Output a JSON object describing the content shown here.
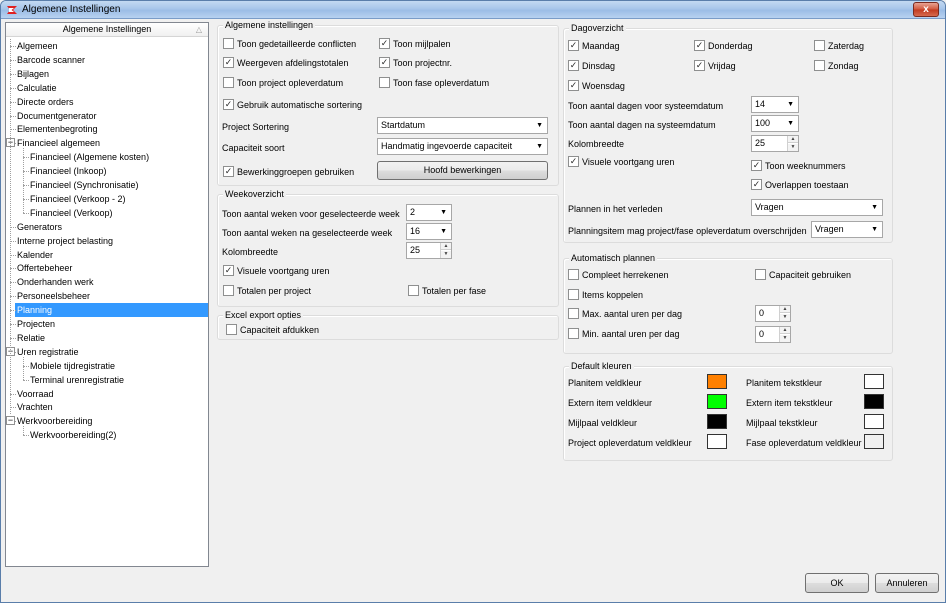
{
  "window": {
    "title": "Algemene Instellingen",
    "close_label": "x"
  },
  "tree": {
    "header": "Algemene Instellingen",
    "items": [
      {
        "label": "Algemeen",
        "level": 0
      },
      {
        "label": "Barcode scanner",
        "level": 0
      },
      {
        "label": "Bijlagen",
        "level": 0
      },
      {
        "label": "Calculatie",
        "level": 0
      },
      {
        "label": "Directe orders",
        "level": 0
      },
      {
        "label": "Documentgenerator",
        "level": 0
      },
      {
        "label": "Elementenbegroting",
        "level": 0
      },
      {
        "label": "Financieel algemeen",
        "level": 0,
        "expander": "-"
      },
      {
        "label": "Financieel (Algemene kosten)",
        "level": 1
      },
      {
        "label": "Financieel (Inkoop)",
        "level": 1
      },
      {
        "label": "Financieel (Synchronisatie)",
        "level": 1
      },
      {
        "label": "Financieel (Verkoop - 2)",
        "level": 1
      },
      {
        "label": "Financieel (Verkoop)",
        "level": 1
      },
      {
        "label": "Generators",
        "level": 0
      },
      {
        "label": "Interne project belasting",
        "level": 0
      },
      {
        "label": "Kalender",
        "level": 0
      },
      {
        "label": "Offertebeheer",
        "level": 0
      },
      {
        "label": "Onderhanden werk",
        "level": 0
      },
      {
        "label": "Personeelsbeheer",
        "level": 0
      },
      {
        "label": "Planning",
        "level": 0,
        "selected": true
      },
      {
        "label": "Projecten",
        "level": 0
      },
      {
        "label": "Relatie",
        "level": 0
      },
      {
        "label": "Uren registratie",
        "level": 0,
        "expander": "-"
      },
      {
        "label": "Mobiele tijdregistratie",
        "level": 1
      },
      {
        "label": "Terminal urenregistratie",
        "level": 1
      },
      {
        "label": "Voorraad",
        "level": 0
      },
      {
        "label": "Vrachten",
        "level": 0
      },
      {
        "label": "Werkvoorbereiding",
        "level": 0,
        "expander": "-"
      },
      {
        "label": "Werkvoorbereiding(2)",
        "level": 1
      }
    ]
  },
  "algemene": {
    "title": "Algemene instellingen",
    "cb_conflicten": "Toon gedetailleerde conflicten",
    "cb_mijlpalen": "Toon mijlpalen",
    "cb_afdelingstotalen": "Weergeven afdelingstotalen",
    "cb_projectnr": "Toon projectnr.",
    "cb_project_opleverdatum": "Toon project opleverdatum",
    "cb_fase_opleverdatum": "Toon fase opleverdatum",
    "cb_sortering": "Gebruik automatische sortering",
    "project_sortering_label": "Project Sortering",
    "project_sortering_value": "Startdatum",
    "capaciteit_soort_label": "Capaciteit soort",
    "capaciteit_soort_value": "Handmatig ingevoerde capaciteit",
    "cb_bewerkingsgroepen": "Bewerkinggroepen gebruiken",
    "hoofd_button": "Hoofd bewerkingen"
  },
  "week": {
    "title": "Weekoverzicht",
    "voor_label": "Toon aantal weken voor geselecteerde week",
    "voor_value": "2",
    "na_label": "Toon aantal weken na geselecteerde week",
    "na_value": "16",
    "kolom_label": "Kolombreedte",
    "kolom_value": "25",
    "cb_voortgang": "Visuele voortgang uren",
    "cb_totalen_project": "Totalen per project",
    "cb_totalen_fase": "Totalen per fase"
  },
  "excel": {
    "title": "Excel export opties",
    "cb_capaciteit": "Capaciteit afdukken"
  },
  "dag": {
    "title": "Dagoverzicht",
    "maandag": "Maandag",
    "donderdag": "Donderdag",
    "zaterdag": "Zaterdag",
    "dinsdag": "Dinsdag",
    "vrijdag": "Vrijdag",
    "zondag": "Zondag",
    "woensdag": "Woensdag",
    "voor_label": "Toon aantal dagen voor systeemdatum",
    "voor_value": "14",
    "na_label": "Toon aantal dagen na systeemdatum",
    "na_value": "100",
    "kolom_label": "Kolombreedte",
    "kolom_value": "25",
    "cb_voortgang": "Visuele voortgang uren",
    "cb_weeknummers": "Toon weeknummers",
    "cb_overlappen": "Overlappen toestaan",
    "verleden_label": "Plannen in het verleden",
    "verleden_value": "Vragen",
    "overschrijden_label": "Planningsitem mag project/fase opleverdatum overschrijden",
    "overschrijden_value": "Vragen"
  },
  "auto": {
    "title": "Automatisch plannen",
    "cb_herrekenen": "Compleet herrekenen",
    "cb_capaciteit": "Capaciteit gebruiken",
    "cb_koppelen": "Items koppelen",
    "cb_max": "Max. aantal uren per dag",
    "max_value": "0",
    "cb_min": "Min. aantal uren per dag",
    "min_value": "0"
  },
  "kleuren": {
    "title": "Default kleuren",
    "planitem_veld": "Planitem veldkleur",
    "planitem_tekst": "Planitem tekstkleur",
    "extern_veld": "Extern item veldkleur",
    "extern_tekst": "Extern item tekstkleur",
    "mijlpaal_veld": "Mijlpaal veldkleur",
    "mijlpaal_tekst": "Mijlpaal tekstkleur",
    "project_veld": "Project opleverdatum veldkleur",
    "fase_veld": "Fase opleverdatum veldkleur",
    "colors": {
      "planitem_veld": "#ff8000",
      "planitem_tekst": "#ffffff",
      "extern_veld": "#00ff00",
      "extern_tekst": "#000000",
      "mijlpaal_veld": "#000000",
      "mijlpaal_tekst": "#ffffff",
      "project_veld": "#ffffff",
      "fase_veld": "#f0f0f0"
    }
  },
  "footer": {
    "ok": "OK",
    "cancel": "Annuleren"
  }
}
